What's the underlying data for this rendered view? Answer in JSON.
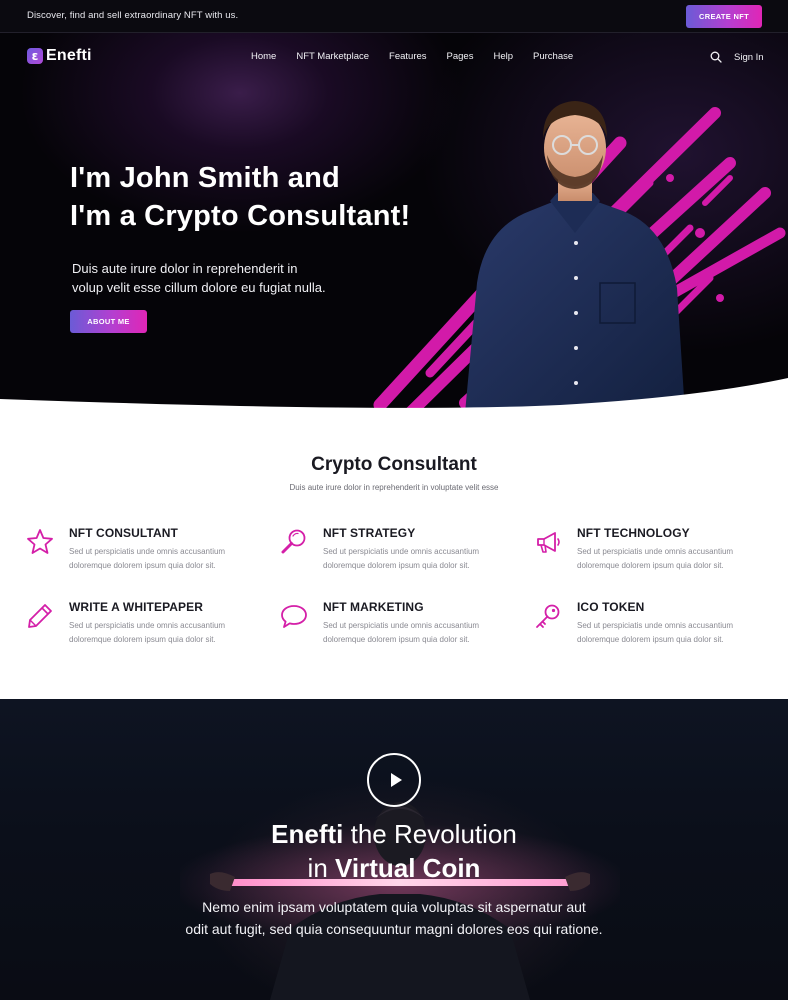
{
  "topbar": {
    "tagline": "Discover, find and sell extraordinary NFT with us.",
    "create_label": "CREATE NFT"
  },
  "brand": {
    "name": "Enefti",
    "mark": "ε"
  },
  "nav": {
    "links": [
      "Home",
      "NFT Marketplace",
      "Features",
      "Pages",
      "Help",
      "Purchase"
    ],
    "signin": "Sign In"
  },
  "hero": {
    "title_line1": "I'm John Smith and",
    "title_line2": "I'm a Crypto Consultant!",
    "desc_line1": "Duis aute irure dolor in reprehenderit in",
    "desc_line2": "volup velit esse cillum dolore eu fugiat nulla.",
    "button": "ABOUT ME"
  },
  "services": {
    "title": "Crypto Consultant",
    "subtitle": "Duis aute irure dolor in reprehenderit in voluptate velit esse",
    "items": [
      {
        "title": "NFT CONSULTANT",
        "line1": "Sed ut perspiciatis unde omnis accusantium",
        "line2": "doloremque dolorem ipsum quia dolor sit.",
        "icon": "star-icon"
      },
      {
        "title": "NFT STRATEGY",
        "line1": "Sed ut perspiciatis unde omnis accusantium",
        "line2": "doloremque dolorem ipsum quia dolor sit.",
        "icon": "magnifier-icon"
      },
      {
        "title": "NFT TECHNOLOGY",
        "line1": "Sed ut perspiciatis unde omnis accusantium",
        "line2": "doloremque dolorem ipsum quia dolor sit.",
        "icon": "megaphone-icon"
      },
      {
        "title": "WRITE A WHITEPAPER",
        "line1": "Sed ut perspiciatis unde omnis accusantium",
        "line2": "doloremque dolorem ipsum quia dolor sit.",
        "icon": "pencil-icon"
      },
      {
        "title": "NFT MARKETING",
        "line1": "Sed ut perspiciatis unde omnis accusantium",
        "line2": "doloremque dolorem ipsum quia dolor sit.",
        "icon": "speech-bubble-icon"
      },
      {
        "title": "ICO TOKEN",
        "line1": "Sed ut perspiciatis unde omnis accusantium",
        "line2": "doloremque dolorem ipsum quia dolor sit.",
        "icon": "key-icon"
      }
    ]
  },
  "revolution": {
    "brand": "Enefti",
    "title_rest1": " the Revolution",
    "title_pre2": "in ",
    "title_bold2": "Virtual Coin",
    "desc_line1": "Nemo enim ipsam voluptatem quia voluptas sit aspernatur aut",
    "desc_line2": "odit aut fugit, sed quia consequuntur magni dolores eos qui ratione."
  },
  "colors": {
    "accent": "#e01fb4",
    "gradient_start": "#6b5bd6",
    "gradient_end": "#e026b6",
    "hero_bg": "#050408",
    "icon_color": "#d41fa8"
  }
}
